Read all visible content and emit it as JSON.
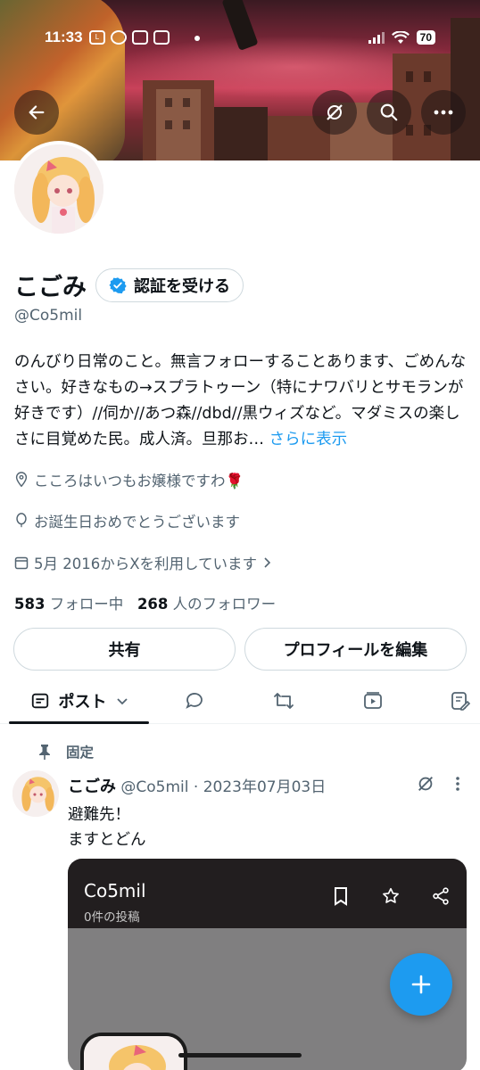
{
  "status_bar": {
    "time": "11:33",
    "battery": "70"
  },
  "profile": {
    "name": "こごみ",
    "verify_label": "認証を受ける",
    "handle": "@Co5mil",
    "bio": "のんびり日常のこと。無言フォローすることあります、ごめんなさい。好きなもの→スプラトゥーン（特にナワバリとサモランが好きです）//伺か//あつ森//dbd//黒ウィズなど。マダミスの楽しさに目覚めた民。成人済。旦那お…",
    "bio_more": "さらに表示",
    "location": "こころはいつもお嬢様ですわ🌹",
    "birthday": "お誕生日おめでとうございます",
    "joined": "5月 2016からXを利用しています",
    "following_count": "583",
    "following_label": "フォロー中",
    "followers_count": "268",
    "followers_label": "人のフォロワー"
  },
  "actions": {
    "share": "共有",
    "edit_profile": "プロフィールを編集"
  },
  "tabs": {
    "posts": "ポスト"
  },
  "pinned_post": {
    "pinned_label": "固定",
    "author": "こごみ",
    "handle": "@Co5mil",
    "date": "2023年07月03日",
    "text_line1": "避難先！",
    "text_line2": "ますとどん",
    "card": {
      "title": "Co5mil",
      "subtitle": "0件の投稿"
    }
  },
  "colors": {
    "accent": "#1d9bf0",
    "text": "#0f1419",
    "secondary": "#536471"
  }
}
